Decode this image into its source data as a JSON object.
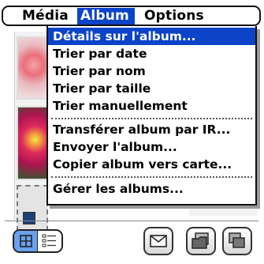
{
  "menubar": {
    "items": [
      {
        "label": "Média"
      },
      {
        "label": "Album"
      },
      {
        "label": "Options"
      }
    ]
  },
  "album_menu": {
    "items": [
      "Détails sur l'album...",
      "Trier par date",
      "Trier par nom",
      "Trier par taille",
      "Trier manuellement",
      "Transférer album par IR...",
      "Envoyer l'album...",
      "Copier album vers carte...",
      "Gérer les albums..."
    ],
    "selected_index": 0
  },
  "toolbar": {
    "view_mode": "thumbnail",
    "icons": [
      "thumbnail-view-icon",
      "list-view-icon",
      "mail-icon",
      "folder-icon",
      "copy-icon"
    ]
  },
  "colors": {
    "highlight": "#0b44c8",
    "segment_active": "#6aa0ee"
  }
}
